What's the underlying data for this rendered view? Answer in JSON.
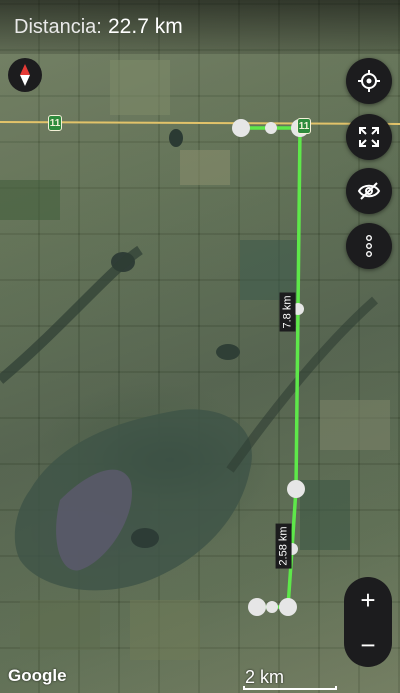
{
  "header": {
    "distance_label": "Distancia:",
    "distance_value": "22.7 km"
  },
  "route": {
    "line_color": "#5ee84a",
    "segment_labels": [
      "7.8 km",
      "2.58 km"
    ]
  },
  "road": {
    "shield_left": "11",
    "shield_right": "11"
  },
  "controls": {
    "compass_icon": "compass-icon",
    "locate_icon": "crosshair-icon",
    "fullscreen_icon": "expand-icon",
    "visibility_icon": "eye-off-icon",
    "more_icon": "more-vertical-icon",
    "zoom_in_label": "+",
    "zoom_out_label": "−"
  },
  "attribution": {
    "logo": "Google"
  },
  "scale": {
    "label": "2 km"
  }
}
